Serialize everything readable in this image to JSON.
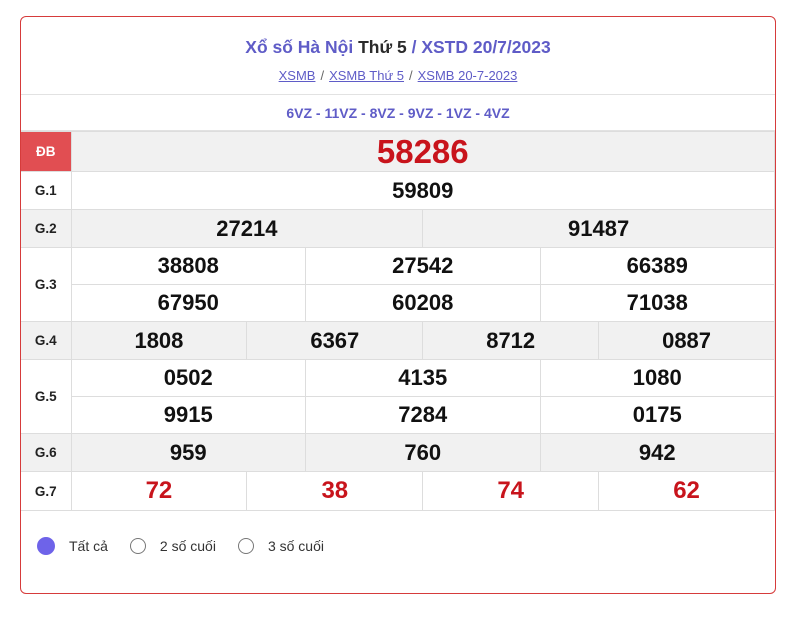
{
  "header": {
    "title_part1": "Xổ số Hà Nội ",
    "title_day": "Thứ 5",
    "title_part2": " / XSTD 20/7/2023",
    "breadcrumb": [
      "XSMB",
      "XSMB Thứ 5",
      "XSMB 20-7-2023"
    ],
    "separator": "/"
  },
  "codes": "6VZ - 11VZ - 8VZ - 9VZ - 1VZ - 4VZ",
  "prizes": {
    "db": {
      "label": "ĐB",
      "numbers": [
        "58286"
      ]
    },
    "g1": {
      "label": "G.1",
      "numbers": [
        "59809"
      ]
    },
    "g2": {
      "label": "G.2",
      "numbers": [
        "27214",
        "91487"
      ]
    },
    "g3": {
      "label": "G.3",
      "numbers": [
        "38808",
        "27542",
        "66389",
        "67950",
        "60208",
        "71038"
      ]
    },
    "g4": {
      "label": "G.4",
      "numbers": [
        "1808",
        "6367",
        "8712",
        "0887"
      ]
    },
    "g5": {
      "label": "G.5",
      "numbers": [
        "0502",
        "4135",
        "1080",
        "9915",
        "7284",
        "0175"
      ]
    },
    "g6": {
      "label": "G.6",
      "numbers": [
        "959",
        "760",
        "942"
      ]
    },
    "g7": {
      "label": "G.7",
      "numbers": [
        "72",
        "38",
        "74",
        "62"
      ]
    }
  },
  "options": [
    {
      "label": "Tất cả",
      "selected": true
    },
    {
      "label": "2 số cuối",
      "selected": false
    },
    {
      "label": "3 số cuối",
      "selected": false
    }
  ],
  "colors": {
    "accent": "#5f5cc7",
    "special": "#c8141c",
    "db_bg": "#e14e52",
    "radio_on": "#6e63e9"
  }
}
